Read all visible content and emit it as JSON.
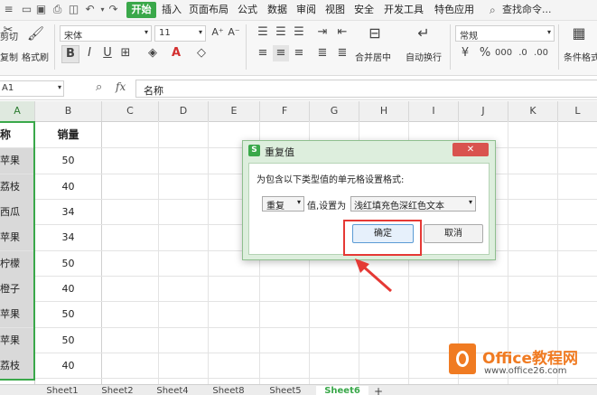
{
  "menubar": {
    "items": [
      "开始",
      "插入",
      "页面布局",
      "公式",
      "数据",
      "审阅",
      "视图",
      "安全",
      "开发工具",
      "特色应用"
    ],
    "search_label": "查找命令..."
  },
  "ribbon": {
    "cut": "剪切",
    "copy": "复制",
    "format_painter": "格式刷",
    "font_name": "宋体",
    "font_size": "11",
    "bold": "B",
    "italic": "I",
    "underline": "U",
    "font_grow": "A⁺",
    "font_shrink": "A⁻",
    "merge_center": "合并居中",
    "auto_wrap": "自动换行",
    "number_format": "常规",
    "conditional_format": "条件格式"
  },
  "formula_bar": {
    "name_box": "A1",
    "fx": "fx",
    "content": "名称"
  },
  "grid": {
    "columns": [
      "A",
      "B",
      "C",
      "D",
      "E",
      "F",
      "G",
      "H",
      "I",
      "J",
      "K",
      "L"
    ],
    "header_a": "称",
    "header_b": "销量",
    "rows": [
      {
        "a": "苹果",
        "b": "50"
      },
      {
        "a": "荔枝",
        "b": "40"
      },
      {
        "a": "西瓜",
        "b": "34"
      },
      {
        "a": "苹果",
        "b": "34"
      },
      {
        "a": "柠檬",
        "b": "50"
      },
      {
        "a": "橙子",
        "b": "40"
      },
      {
        "a": "苹果",
        "b": "50"
      },
      {
        "a": "苹果",
        "b": "50"
      },
      {
        "a": "荔枝",
        "b": "40"
      }
    ]
  },
  "sheets": [
    "Sheet1",
    "Sheet2",
    "Sheet4",
    "Sheet8",
    "Sheet5",
    "Sheet6"
  ],
  "active_sheet": "Sheet6",
  "add_sheet": "+",
  "dialog": {
    "icon_letter": "S",
    "title": "重复值",
    "close": "✕",
    "prompt": "为包含以下类型值的单元格设置格式:",
    "type_select": "重复",
    "value_set_label": "值,设置为",
    "format_select": "浅红填充色深红色文本",
    "ok": "确定",
    "cancel": "取消"
  },
  "watermark": {
    "brand": "Office教程网",
    "url": "www.office26.com"
  },
  "colors": {
    "accent_green": "#3aa84a",
    "highlight_red": "#e53935",
    "brand_orange": "#f07b22"
  }
}
